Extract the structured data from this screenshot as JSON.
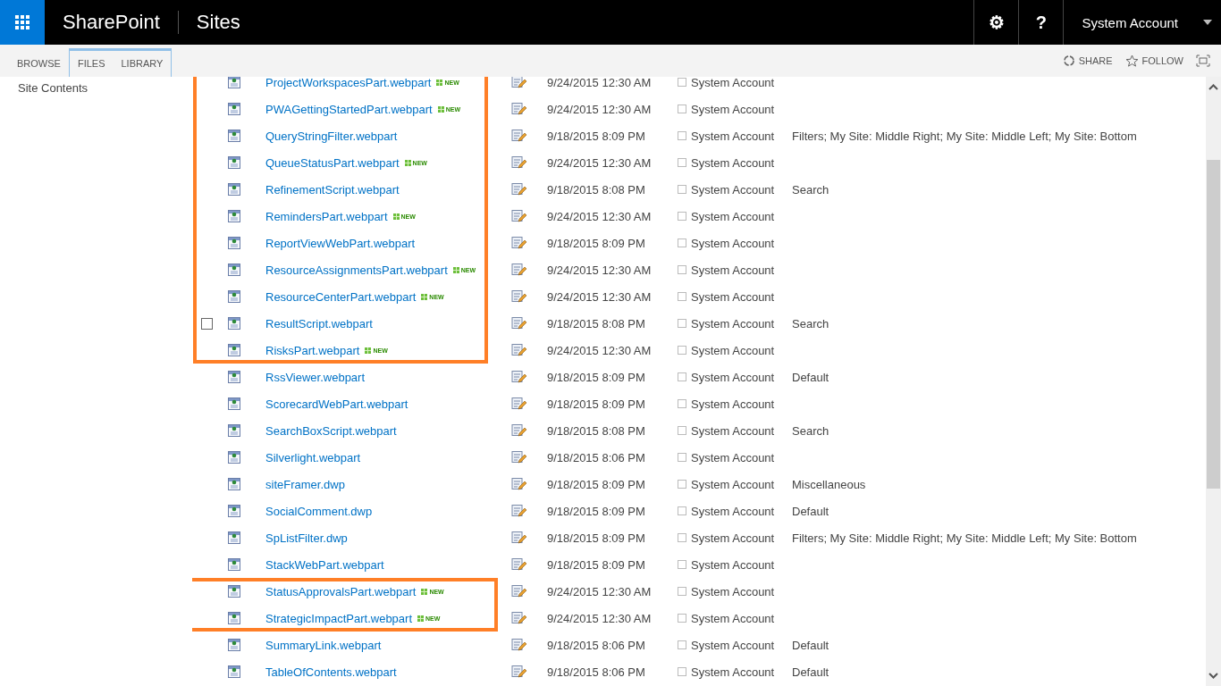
{
  "top_bar": {
    "brand": "SharePoint",
    "section": "Sites",
    "user": "System Account",
    "settings_glyph": "⚙",
    "help_glyph": "?"
  },
  "ribbon": {
    "tabs": [
      {
        "label": "BROWSE",
        "contextual": false
      },
      {
        "label": "FILES",
        "contextual": true
      },
      {
        "label": "LIBRARY",
        "contextual": true
      }
    ],
    "actions": [
      {
        "label": "SHARE",
        "kind": "share"
      },
      {
        "label": "FOLLOW",
        "kind": "follow"
      }
    ]
  },
  "sidebar": {
    "items": [
      "Site Contents"
    ]
  },
  "sections": [
    {
      "highlighted": true,
      "rows": [
        {
          "name": "ProjectWorkspacesPart.webpart",
          "new": true,
          "new_label": "NEW",
          "modified": "9/24/2015 12:30 AM",
          "author": "System Account",
          "hovered": false
        },
        {
          "name": "PWAGettingStartedPart.webpart",
          "new": true,
          "new_label": "NEW",
          "modified": "9/24/2015 12:30 AM",
          "author": "System Account",
          "hovered": false
        },
        {
          "name": "QueryStringFilter.webpart",
          "new": false,
          "modified": "9/18/2015 8:09 PM",
          "author": "System Account",
          "group": "Filters; My Site: Middle Right; My Site: Middle Left; My Site: Bottom",
          "hovered": false
        },
        {
          "name": "QueueStatusPart.webpart",
          "new": true,
          "new_label": "NEW",
          "modified": "9/24/2015 12:30 AM",
          "author": "System Account",
          "hovered": false
        },
        {
          "name": "RefinementScript.webpart",
          "new": false,
          "modified": "9/18/2015 8:08 PM",
          "author": "System Account",
          "group": "Search",
          "hovered": false
        },
        {
          "name": "RemindersPart.webpart",
          "new": true,
          "new_label": "NEW",
          "modified": "9/24/2015 12:30 AM",
          "author": "System Account",
          "hovered": false
        },
        {
          "name": "ReportViewWebPart.webpart",
          "new": false,
          "modified": "9/18/2015 8:09 PM",
          "author": "System Account",
          "hovered": false
        },
        {
          "name": "ResourceAssignmentsPart.webpart",
          "new": true,
          "new_label": "NEW",
          "modified": "9/24/2015 12:30 AM",
          "author": "System Account",
          "hovered": false
        },
        {
          "name": "ResourceCenterPart.webpart",
          "new": true,
          "new_label": "NEW",
          "modified": "9/24/2015 12:30 AM",
          "author": "System Account",
          "hovered": false
        },
        {
          "name": "ResultScript.webpart",
          "new": false,
          "modified": "9/18/2015 8:08 PM",
          "author": "System Account",
          "group": "Search",
          "hovered": true
        },
        {
          "name": "RisksPart.webpart",
          "new": true,
          "new_label": "NEW",
          "modified": "9/24/2015 12:30 AM",
          "author": "System Account",
          "hovered": false
        }
      ]
    },
    {
      "highlighted": false,
      "rows": [
        {
          "name": "RssViewer.webpart",
          "new": false,
          "modified": "9/18/2015 8:09 PM",
          "author": "System Account",
          "group": "Default",
          "hovered": false
        },
        {
          "name": "ScorecardWebPart.webpart",
          "new": false,
          "modified": "9/18/2015 8:09 PM",
          "author": "System Account",
          "hovered": false
        },
        {
          "name": "SearchBoxScript.webpart",
          "new": false,
          "modified": "9/18/2015 8:08 PM",
          "author": "System Account",
          "group": "Search",
          "hovered": false
        },
        {
          "name": "Silverlight.webpart",
          "new": false,
          "modified": "9/18/2015 8:06 PM",
          "author": "System Account",
          "hovered": false
        },
        {
          "name": "siteFramer.dwp",
          "new": false,
          "modified": "9/18/2015 8:09 PM",
          "author": "System Account",
          "group": "Miscellaneous",
          "hovered": false
        },
        {
          "name": "SocialComment.dwp",
          "new": false,
          "modified": "9/18/2015 8:09 PM",
          "author": "System Account",
          "group": "Default",
          "hovered": false
        },
        {
          "name": "SpListFilter.dwp",
          "new": false,
          "modified": "9/18/2015 8:09 PM",
          "author": "System Account",
          "group": "Filters; My Site: Middle Right; My Site: Middle Left; My Site: Bottom",
          "hovered": false
        },
        {
          "name": "StackWebPart.webpart",
          "new": false,
          "modified": "9/18/2015 8:09 PM",
          "author": "System Account",
          "hovered": false
        }
      ]
    },
    {
      "highlighted": true,
      "rows": [
        {
          "name": "StatusApprovalsPart.webpart",
          "new": true,
          "new_label": "NEW",
          "modified": "9/24/2015 12:30 AM",
          "author": "System Account",
          "hovered": false
        },
        {
          "name": "StrategicImpactPart.webpart",
          "new": true,
          "new_label": "NEW",
          "modified": "9/24/2015 12:30 AM",
          "author": "System Account",
          "hovered": false
        }
      ]
    },
    {
      "highlighted": false,
      "rows": [
        {
          "name": "SummaryLink.webpart",
          "new": false,
          "modified": "9/18/2015 8:06 PM",
          "author": "System Account",
          "group": "Default",
          "hovered": false
        },
        {
          "name": "TableOfContents.webpart",
          "new": false,
          "modified": "9/18/2015 8:06 PM",
          "author": "System Account",
          "group": "Default",
          "hovered": false
        }
      ]
    }
  ]
}
